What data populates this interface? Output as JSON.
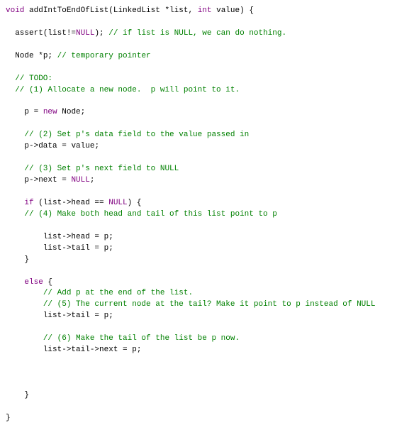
{
  "code": {
    "l1_type": "void",
    "l1_fn": "addIntToEndOfList",
    "l1_paren_open": "(",
    "l1_ptype1": "LinkedList",
    "l1_star1": "*",
    "l1_param1": "list",
    "l1_comma": ", ",
    "l1_ptype2": "int",
    "l1_param2": " value",
    "l1_paren_close": ")",
    "l1_brace": " {",
    "l3_indent": "  ",
    "l3_assert": "assert",
    "l3_open": "(",
    "l3_listid": "list",
    "l3_neq": "!=",
    "l3_null": "NULL",
    "l3_close": ");",
    "l3_cmt": " // if list is NULL, we can do nothing.",
    "l5_indent": "  ",
    "l5_type": "Node",
    "l5_star": " *",
    "l5_id": "p",
    "l5_semi": ";",
    "l5_cmt": " // temporary pointer",
    "l7_indent": "  ",
    "l7_cmt": "// TODO:",
    "l8_indent": "  ",
    "l8_cmt": "// (1) Allocate a new node.  p will point to it.",
    "l10_indent": "    ",
    "l10_id": "p",
    "l10_eq": " = ",
    "l10_new": "new",
    "l10_sp": " ",
    "l10_type": "Node",
    "l10_semi": ";",
    "l12_indent": "    ",
    "l12_cmt": "// (2) Set p's data field to the value passed in",
    "l13_indent": "    ",
    "l13_lhs": "p->data",
    "l13_eq": " = ",
    "l13_rhs": "value",
    "l13_semi": ";",
    "l15_indent": "    ",
    "l15_cmt": "// (3) Set p's next field to NULL",
    "l16_indent": "    ",
    "l16_lhs": "p->next",
    "l16_eq": " = ",
    "l16_null": "NULL",
    "l16_semi": ";",
    "l18_indent": "    ",
    "l18_if": "if",
    "l18_sp": " (",
    "l18_cond_l": "list->head",
    "l18_cond_op": " == ",
    "l18_cond_r": "NULL",
    "l18_close": ") {",
    "l19_indent": "    ",
    "l19_cmt": "// (4) Make both head and tail of this list point to p",
    "l21_indent": "        ",
    "l21_lhs": "list->head",
    "l21_eq": " = ",
    "l21_rhs": "p",
    "l21_semi": ";",
    "l22_indent": "        ",
    "l22_lhs": "list->tail",
    "l22_eq": " = ",
    "l22_rhs": "p",
    "l22_semi": ";",
    "l23_indent": "    ",
    "l23_brace": "}",
    "l25_indent": "    ",
    "l25_else": "else",
    "l25_brace": " {",
    "l26_indent": "        ",
    "l26_cmt": "// Add p at the end of the list.",
    "l27_indent": "        ",
    "l27_cmt": "// (5) The current node at the tail? Make it point to p instead of NULL",
    "l28_indent": "        ",
    "l28_lhs": "list->tail",
    "l28_eq": " = ",
    "l28_rhs": "p",
    "l28_semi": ";",
    "l30_indent": "        ",
    "l30_cmt": "// (6) Make the tail of the list be p now.",
    "l31_indent": "        ",
    "l31_lhs": "list->tail->next",
    "l31_eq": " = ",
    "l31_rhs": "p",
    "l31_semi": ";",
    "l36_indent": "    ",
    "l36_brace": "}",
    "l38_brace": "}"
  }
}
